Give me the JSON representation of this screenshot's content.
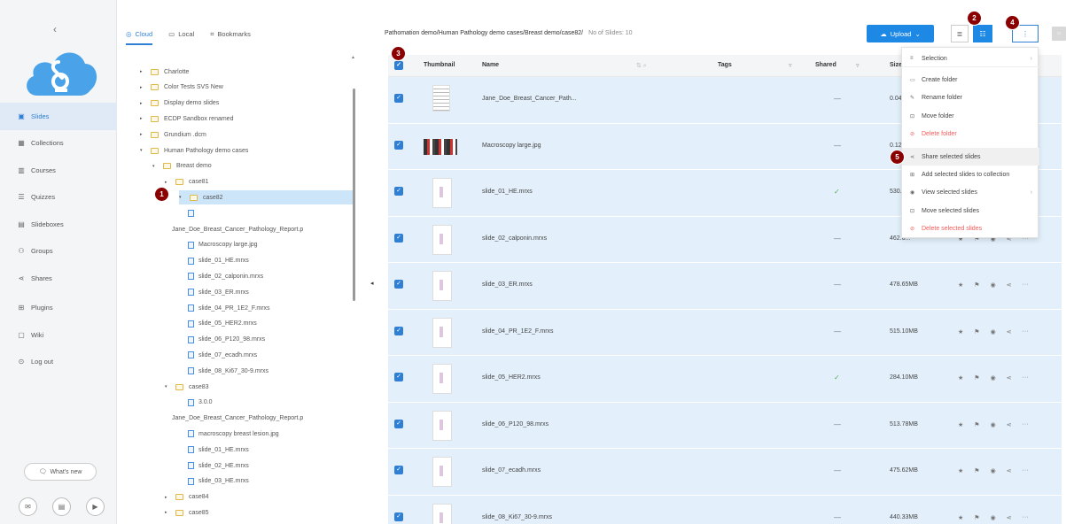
{
  "nav": {
    "collapse_icon": "chevron-left-icon",
    "items": [
      {
        "label": "Slides",
        "icon": "slides-icon",
        "active": true
      },
      {
        "label": "Collections",
        "icon": "collections-icon"
      },
      {
        "label": "Courses",
        "icon": "courses-icon"
      },
      {
        "label": "Quizzes",
        "icon": "quizzes-icon"
      },
      {
        "label": "Slideboxes",
        "icon": "slideboxes-icon"
      },
      {
        "label": "Groups",
        "icon": "groups-icon"
      },
      {
        "label": "Shares",
        "icon": "shares-icon"
      },
      {
        "label": "Plugins",
        "icon": "plugins-icon"
      },
      {
        "label": "Wiki",
        "icon": "wiki-icon"
      },
      {
        "label": "Log out",
        "icon": "logout-icon"
      }
    ],
    "whats_new": "What's new"
  },
  "tree": {
    "tabs": [
      {
        "label": "Cloud",
        "icon": "cloud-icon",
        "active": true
      },
      {
        "label": "Local",
        "icon": "monitor-icon"
      },
      {
        "label": "Bookmarks",
        "icon": "bookmark-icon"
      }
    ],
    "rows": [
      {
        "label": "Charlotte",
        "type": "folder",
        "arrow": "▸"
      },
      {
        "label": "Color Tests SVS New",
        "type": "folder",
        "arrow": "▸"
      },
      {
        "label": "Display demo slides",
        "type": "folder",
        "arrow": "▸"
      },
      {
        "label": "ECDP Sandbox renamed",
        "type": "folder",
        "arrow": "▸"
      },
      {
        "label": "Grundium .dcm",
        "type": "folder",
        "arrow": "▸"
      },
      {
        "label": "Human Pathology demo cases",
        "type": "folder",
        "arrow": "▾"
      },
      {
        "label": "Breast demo",
        "type": "folder",
        "arrow": "▾"
      },
      {
        "label": "case81",
        "type": "folder",
        "arrow": "▸"
      },
      {
        "label": "case82",
        "type": "folder",
        "arrow": "▾",
        "selected": true
      },
      {
        "label": "",
        "type": "file",
        "arrow": ""
      },
      {
        "label": "Jane_Doe_Breast_Cancer_Pathology_Report.p",
        "type": "text",
        "arrow": ""
      },
      {
        "label": "Macroscopy large.jpg",
        "type": "file",
        "arrow": ""
      },
      {
        "label": "slide_01_HE.mrxs",
        "type": "file",
        "arrow": ""
      },
      {
        "label": "slide_02_calponin.mrxs",
        "type": "file",
        "arrow": ""
      },
      {
        "label": "slide_03_ER.mrxs",
        "type": "file",
        "arrow": ""
      },
      {
        "label": "slide_04_PR_1E2_F.mrxs",
        "type": "file",
        "arrow": ""
      },
      {
        "label": "slide_05_HER2.mrxs",
        "type": "file",
        "arrow": ""
      },
      {
        "label": "slide_06_P120_98.mrxs",
        "type": "file",
        "arrow": ""
      },
      {
        "label": "slide_07_ecadh.mrxs",
        "type": "file",
        "arrow": ""
      },
      {
        "label": "slide_08_Ki67_30-9.mrxs",
        "type": "file",
        "arrow": ""
      },
      {
        "label": "case83",
        "type": "folder",
        "arrow": "▾"
      },
      {
        "label": "3.0.0",
        "type": "file",
        "arrow": ""
      },
      {
        "label": "Jane_Doe_Breast_Cancer_Pathology_Report.p",
        "type": "text",
        "arrow": ""
      },
      {
        "label": "macroscopy breast lesion.jpg",
        "type": "file",
        "arrow": ""
      },
      {
        "label": "slide_01_HE.mrxs",
        "type": "file",
        "arrow": ""
      },
      {
        "label": "slide_02_HE.mrxs",
        "type": "file",
        "arrow": ""
      },
      {
        "label": "slide_03_HE.mrxs",
        "type": "file",
        "arrow": ""
      },
      {
        "label": "case84",
        "type": "folder",
        "arrow": "▸"
      },
      {
        "label": "case85",
        "type": "folder",
        "arrow": "▸"
      }
    ]
  },
  "main": {
    "breadcrumb": "Pathomation demo/Human Pathology demo cases/Breast demo/case82/",
    "slide_count": "No of Slides: 10",
    "upload_label": "Upload",
    "columns": {
      "thumbnail": "Thumbnail",
      "name": "Name",
      "tags": "Tags",
      "shared": "Shared",
      "size": "Size"
    },
    "rows": [
      {
        "name": "Jane_Doe_Breast_Cancer_Path...",
        "shared": "—",
        "size": "0.04",
        "thumb": "doc"
      },
      {
        "name": "Macroscopy large.jpg",
        "shared": "—",
        "size": "0.12",
        "thumb": "macro"
      },
      {
        "name": "slide_01_HE.mrxs",
        "shared": "✓",
        "size": "530.4",
        "thumb": "slide"
      },
      {
        "name": "slide_02_calponin.mrxs",
        "shared": "—",
        "size": "462.6...",
        "thumb": "slide"
      },
      {
        "name": "slide_03_ER.mrxs",
        "shared": "—",
        "size": "478.65MB",
        "thumb": "slide"
      },
      {
        "name": "slide_04_PR_1E2_F.mrxs",
        "shared": "—",
        "size": "515.10MB",
        "thumb": "slide"
      },
      {
        "name": "slide_05_HER2.mrxs",
        "shared": "✓",
        "size": "284.10MB",
        "thumb": "slide"
      },
      {
        "name": "slide_06_P120_98.mrxs",
        "shared": "—",
        "size": "513.78MB",
        "thumb": "slide"
      },
      {
        "name": "slide_07_ecadh.mrxs",
        "shared": "—",
        "size": "475.62MB",
        "thumb": "slide"
      },
      {
        "name": "slide_08_Ki67_30-9.mrxs",
        "shared": "—",
        "size": "440.33MB",
        "thumb": "slide"
      }
    ]
  },
  "menu": {
    "items": [
      {
        "label": "Selection",
        "icon": "selection-icon",
        "chev": true
      },
      {
        "label": "Create folder",
        "icon": "create-folder-icon"
      },
      {
        "label": "Rename folder",
        "icon": "rename-icon"
      },
      {
        "label": "Move folder",
        "icon": "move-icon"
      },
      {
        "label": "Delete folder",
        "icon": "delete-icon",
        "danger": true
      },
      {
        "label": "Share selected slides",
        "icon": "share-icon",
        "hover": true
      },
      {
        "label": "Add selected slides to collection",
        "icon": "collection-add-icon"
      },
      {
        "label": "View selected slides",
        "icon": "view-icon",
        "chev": true
      },
      {
        "label": "Move selected slides",
        "icon": "move-icon"
      },
      {
        "label": "Delete selected slides",
        "icon": "delete-icon",
        "danger": true
      }
    ]
  },
  "badges": [
    "1",
    "2",
    "3",
    "4",
    "5"
  ],
  "colors": {
    "accent": "#1e88e5",
    "row_selected": "#e3f0fb",
    "danger": "#f05a5a",
    "badge": "#8b0000"
  }
}
